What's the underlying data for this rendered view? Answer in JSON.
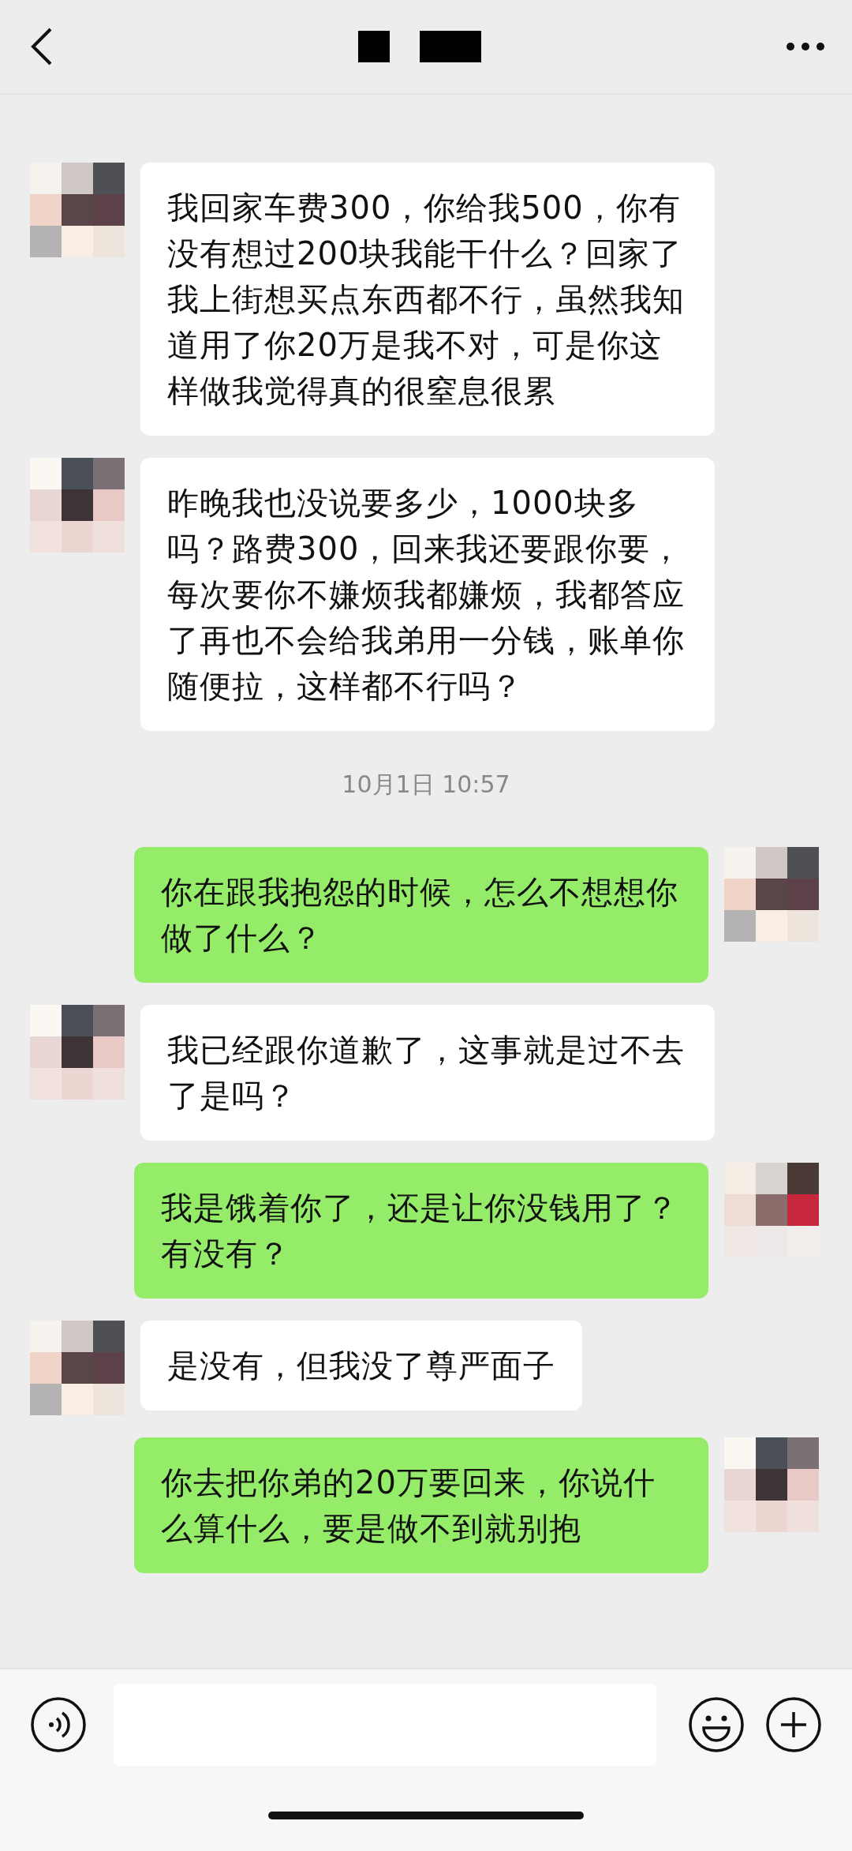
{
  "messages": [
    {
      "kind": "received",
      "text": "我回家车费300，你给我500，你有没有想过200块我能干什么？回家了我上街想买点东西都不行，虽然我知道用了你20万是我不对，可是你这样做我觉得真的很窒息很累"
    },
    {
      "kind": "received",
      "text": "昨晚我也没说要多少，1000块多吗？路费300，回来我还要跟你要，每次要你不嫌烦我都嫌烦，我都答应了再也不会给我弟用一分钱，账单你随便拉，这样都不行吗？"
    },
    {
      "kind": "time",
      "text": "10月1日 10:57"
    },
    {
      "kind": "sent",
      "text": "你在跟我抱怨的时候，怎么不想想你做了什么？"
    },
    {
      "kind": "received",
      "text": "我已经跟你道歉了，这事就是过不去了是吗？"
    },
    {
      "kind": "sent",
      "text": "我是饿着你了，还是让你没钱用了？有没有？"
    },
    {
      "kind": "received",
      "text": "是没有，但我没了尊严面子"
    },
    {
      "kind": "sent",
      "text": "你去把你弟的20万要回来，你说什么算什么，要是做不到就别抱"
    }
  ]
}
